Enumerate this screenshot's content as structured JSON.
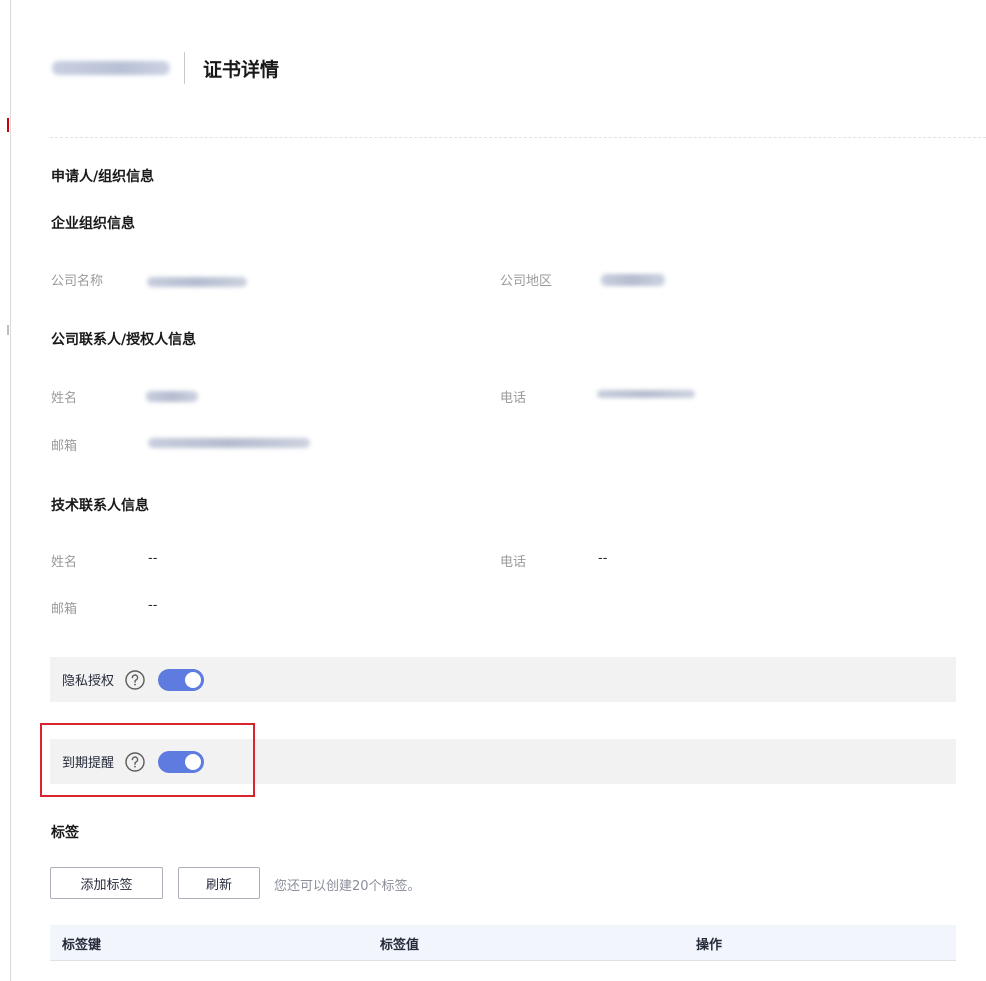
{
  "header": {
    "breadcrumb": "",
    "title": "证书详情"
  },
  "applicant": {
    "section_title": "申请人/组织信息",
    "org": {
      "title": "企业组织信息",
      "company_name_label": "公司名称",
      "company_region_label": "公司地区"
    },
    "contact": {
      "title": "公司联系人/授权人信息",
      "name_label": "姓名",
      "phone_label": "电话",
      "email_label": "邮箱"
    },
    "tech": {
      "title": "技术联系人信息",
      "name_label": "姓名",
      "name_value": "--",
      "phone_label": "电话",
      "phone_value": "--",
      "email_label": "邮箱",
      "email_value": "--"
    }
  },
  "settings": {
    "privacy": {
      "label": "隐私授权",
      "enabled": true
    },
    "expiry_reminder": {
      "label": "到期提醒",
      "enabled": true
    }
  },
  "tags": {
    "title": "标签",
    "add_button": "添加标签",
    "refresh_button": "刷新",
    "hint": "您还可以创建20个标签。",
    "columns": [
      "标签键",
      "标签值",
      "操作"
    ]
  },
  "colors": {
    "accent": "#5e7ce0",
    "highlight_border": "#d7262d",
    "table_header_bg": "#f2f5fc"
  },
  "icons": {
    "help": "help-circle-icon"
  }
}
